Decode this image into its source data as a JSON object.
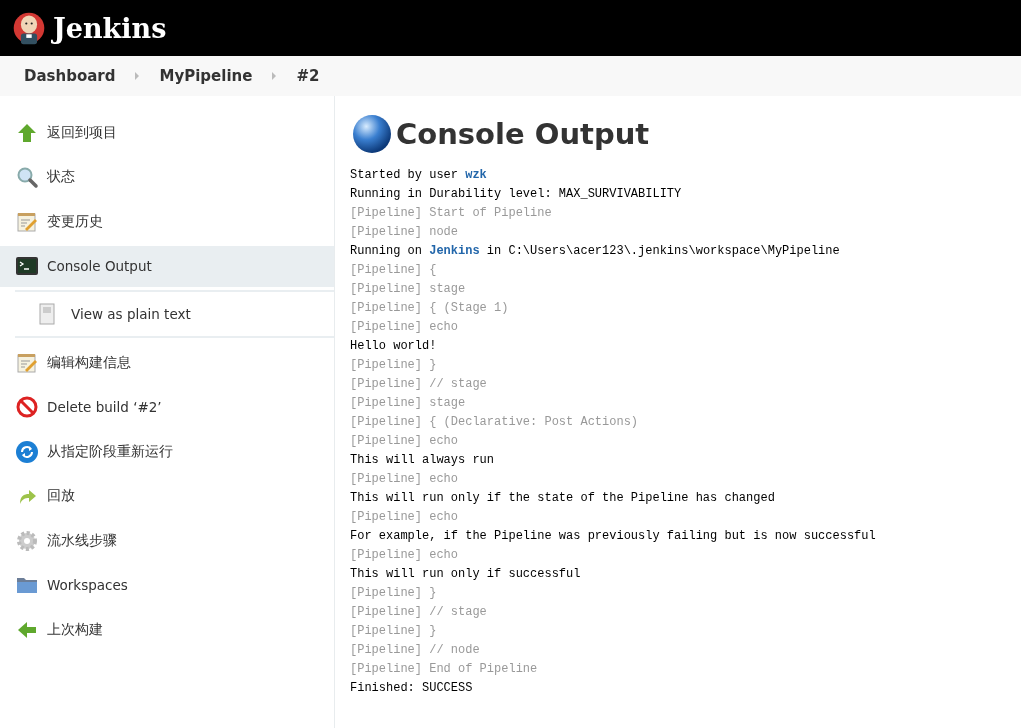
{
  "header": {
    "title": "Jenkins"
  },
  "breadcrumbs": [
    {
      "label": "Dashboard"
    },
    {
      "label": "MyPipeline"
    },
    {
      "label": "#2"
    }
  ],
  "sidebar": {
    "items": [
      {
        "kind": "up-arrow",
        "label": "返回到项目",
        "selected": false
      },
      {
        "kind": "search",
        "label": "状态",
        "selected": false
      },
      {
        "kind": "notepad",
        "label": "变更历史",
        "selected": false
      },
      {
        "kind": "terminal",
        "label": "Console Output",
        "selected": true,
        "children": [
          {
            "kind": "document",
            "label": "View as plain text",
            "selected": false
          }
        ]
      },
      {
        "kind": "notepad",
        "label": "编辑构建信息",
        "selected": false
      },
      {
        "kind": "no-entry",
        "label": "Delete build ‘#2’",
        "selected": false
      },
      {
        "kind": "refresh",
        "label": "从指定阶段重新运行",
        "selected": false
      },
      {
        "kind": "redo-arrow",
        "label": "回放",
        "selected": false
      },
      {
        "kind": "gear",
        "label": "流水线步骤",
        "selected": false
      },
      {
        "kind": "folder",
        "label": "Workspaces",
        "selected": false
      },
      {
        "kind": "left-arrow",
        "label": "上次构建",
        "selected": false
      }
    ]
  },
  "main": {
    "title": "Console Output",
    "console": [
      {
        "kind": "output",
        "segments": [
          {
            "text": "Started by user "
          },
          {
            "text": "wzk",
            "link": true
          }
        ]
      },
      {
        "kind": "output",
        "segments": [
          {
            "text": "Running in Durability level: MAX_SURVIVABILITY"
          }
        ]
      },
      {
        "kind": "pipeline",
        "segments": [
          {
            "text": "[Pipeline] Start of Pipeline"
          }
        ]
      },
      {
        "kind": "pipeline",
        "segments": [
          {
            "text": "[Pipeline] node"
          }
        ]
      },
      {
        "kind": "output",
        "segments": [
          {
            "text": "Running on "
          },
          {
            "text": "Jenkins",
            "link": true
          },
          {
            "text": " in C:\\Users\\acer123\\.jenkins\\workspace\\MyPipeline"
          }
        ]
      },
      {
        "kind": "pipeline",
        "segments": [
          {
            "text": "[Pipeline] {"
          }
        ]
      },
      {
        "kind": "pipeline",
        "segments": [
          {
            "text": "[Pipeline] stage"
          }
        ]
      },
      {
        "kind": "pipeline",
        "segments": [
          {
            "text": "[Pipeline] { (Stage 1)"
          }
        ]
      },
      {
        "kind": "pipeline",
        "segments": [
          {
            "text": "[Pipeline] echo"
          }
        ]
      },
      {
        "kind": "output",
        "segments": [
          {
            "text": "Hello world!"
          }
        ]
      },
      {
        "kind": "pipeline",
        "segments": [
          {
            "text": "[Pipeline] }"
          }
        ]
      },
      {
        "kind": "pipeline",
        "segments": [
          {
            "text": "[Pipeline] // stage"
          }
        ]
      },
      {
        "kind": "pipeline",
        "segments": [
          {
            "text": "[Pipeline] stage"
          }
        ]
      },
      {
        "kind": "pipeline",
        "segments": [
          {
            "text": "[Pipeline] { (Declarative: Post Actions)"
          }
        ]
      },
      {
        "kind": "pipeline",
        "segments": [
          {
            "text": "[Pipeline] echo"
          }
        ]
      },
      {
        "kind": "output",
        "segments": [
          {
            "text": "This will always run"
          }
        ]
      },
      {
        "kind": "pipeline",
        "segments": [
          {
            "text": "[Pipeline] echo"
          }
        ]
      },
      {
        "kind": "output",
        "segments": [
          {
            "text": "This will run only if the state of the Pipeline has changed"
          }
        ]
      },
      {
        "kind": "pipeline",
        "segments": [
          {
            "text": "[Pipeline] echo"
          }
        ]
      },
      {
        "kind": "output",
        "segments": [
          {
            "text": "For example, if the Pipeline was previously failing but is now successful"
          }
        ]
      },
      {
        "kind": "pipeline",
        "segments": [
          {
            "text": "[Pipeline] echo"
          }
        ]
      },
      {
        "kind": "output",
        "segments": [
          {
            "text": "This will run only if successful"
          }
        ]
      },
      {
        "kind": "pipeline",
        "segments": [
          {
            "text": "[Pipeline] }"
          }
        ]
      },
      {
        "kind": "pipeline",
        "segments": [
          {
            "text": "[Pipeline] // stage"
          }
        ]
      },
      {
        "kind": "pipeline",
        "segments": [
          {
            "text": "[Pipeline] }"
          }
        ]
      },
      {
        "kind": "pipeline",
        "segments": [
          {
            "text": "[Pipeline] // node"
          }
        ]
      },
      {
        "kind": "pipeline",
        "segments": [
          {
            "text": "[Pipeline] End of Pipeline"
          }
        ]
      },
      {
        "kind": "output",
        "segments": [
          {
            "text": "Finished: SUCCESS"
          }
        ]
      }
    ]
  }
}
